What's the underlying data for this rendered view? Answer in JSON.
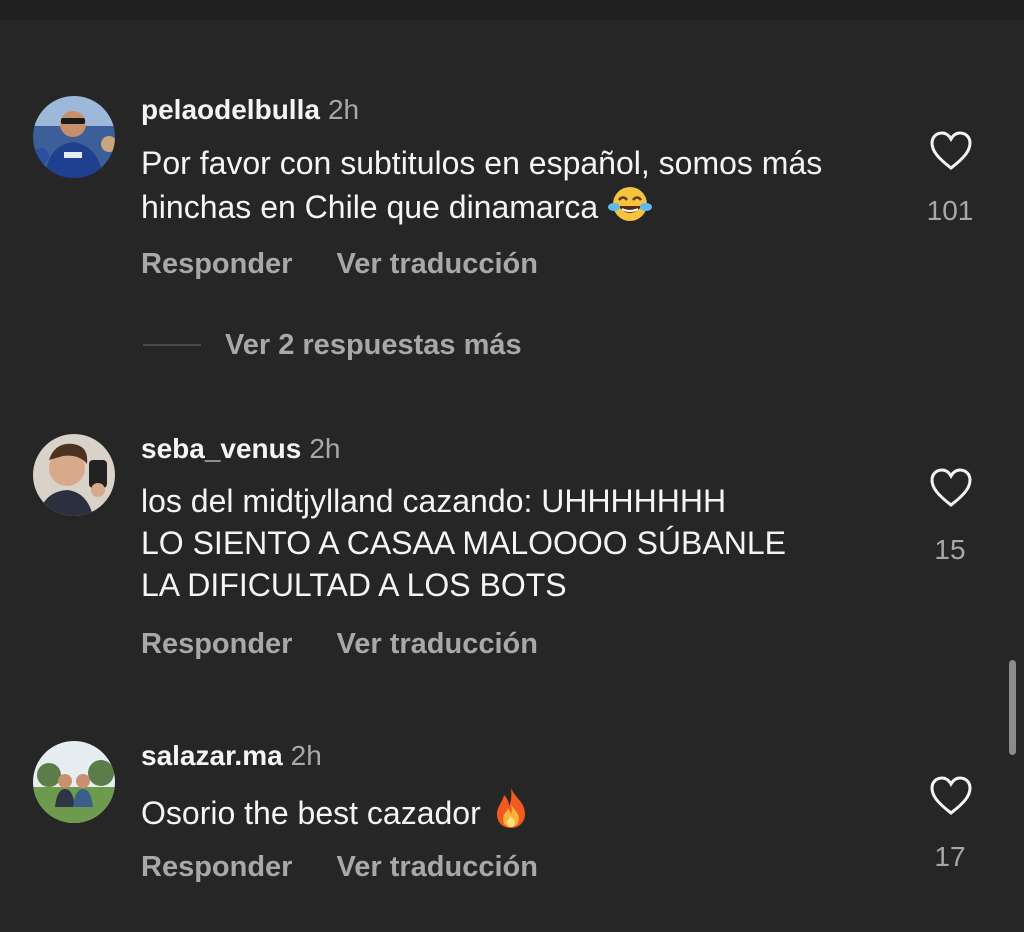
{
  "comments": [
    {
      "username": "pelaodelbulla",
      "time": "2h",
      "text": "Por favor con subtitulos en español, somos más hinchas en Chile que dinamarca",
      "emoji": "face-with-tears-of-joy",
      "likes": "101",
      "reply_label": "Responder",
      "translate_label": "Ver traducción",
      "more_replies_label": "Ver 2 respuestas más"
    },
    {
      "username": "seba_venus",
      "time": "2h",
      "text_lines": [
        "los del midtjylland cazando: UHHHHHHH",
        "LO SIENTO A CASAA MALOOOO SÚBANLE",
        "LA DIFICULTAD A LOS BOTS"
      ],
      "likes": "15",
      "reply_label": "Responder",
      "translate_label": "Ver traducción"
    },
    {
      "username": "salazar.ma",
      "time": "2h",
      "text": "Osorio the best cazador",
      "emoji": "fire",
      "likes": "17",
      "reply_label": "Responder",
      "translate_label": "Ver traducción"
    }
  ],
  "colors": {
    "background": "#262626",
    "primary_text": "#f5f5f5",
    "secondary_text": "#a8a8a8"
  }
}
